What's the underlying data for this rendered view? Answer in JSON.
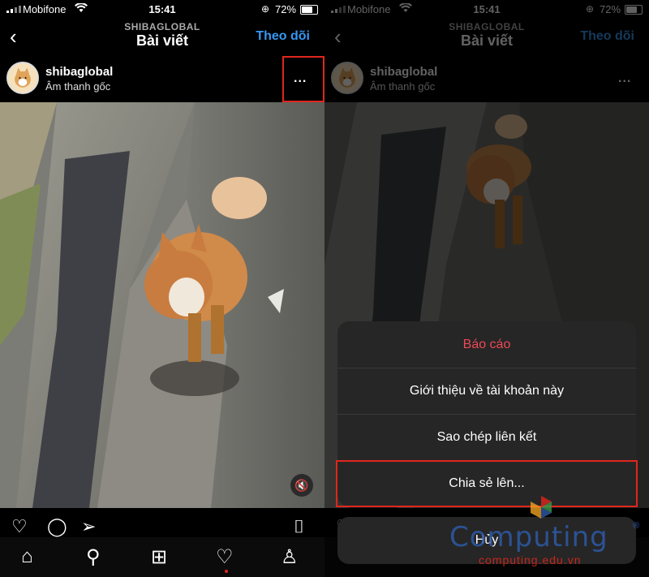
{
  "status": {
    "carrier": "Mobifone",
    "time": "15:41",
    "battery": "72%"
  },
  "nav": {
    "account_caps": "SHIBAGLOBAL",
    "title": "Bài viết",
    "follow": "Theo dõi"
  },
  "post": {
    "username": "shibaglobal",
    "audio": "Âm thanh gốc",
    "more": "..."
  },
  "sheet": {
    "report": "Báo cáo",
    "about": "Giới thiệu về tài khoản này",
    "copy_link": "Sao chép liên kết",
    "share": "Chia sẻ lên...",
    "cancel": "Hủy"
  },
  "watermark": {
    "brand": "Computing",
    "domain": "computing.edu.vn",
    "reg": "®"
  },
  "colors": {
    "accent": "#3897f0",
    "highlight": "#e0261c",
    "report": "#ed4956",
    "sheet_bg": "#262626"
  }
}
